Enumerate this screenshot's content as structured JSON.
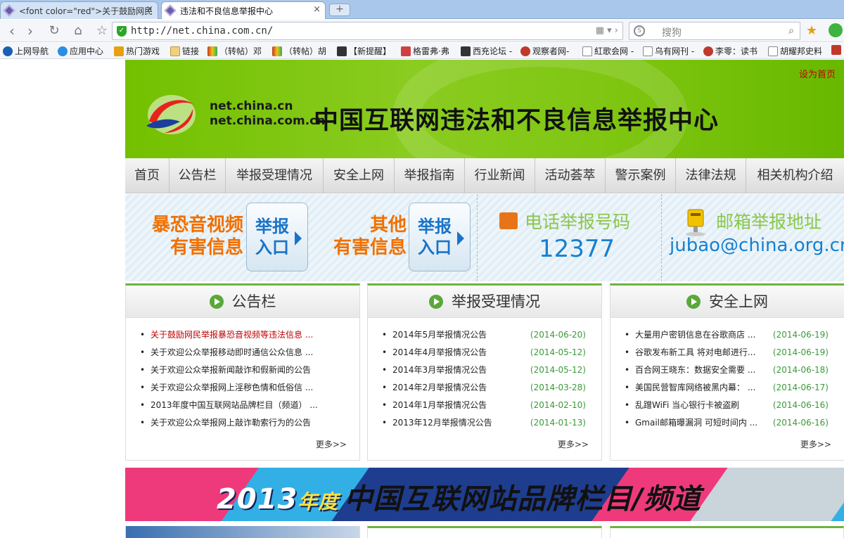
{
  "browser": {
    "tabs": [
      {
        "title": "<font color=\"red\">关于鼓励网民",
        "active": false
      },
      {
        "title": "违法和不良信息举报中心",
        "active": true
      }
    ],
    "new_tab": "+",
    "url": "http://net.china.com.cn/",
    "search_placeholder": "搜狗",
    "bookmarks": [
      {
        "label": "上网导航",
        "icon": "ie-icon",
        "color": "#1a5fb4"
      },
      {
        "label": "应用中心",
        "icon": "app-center-icon",
        "color": "#2a8ee6"
      },
      {
        "label": "热门游戏",
        "icon": "star-icon",
        "color": "#e6a013"
      },
      {
        "label": "链接",
        "icon": "folder-icon",
        "color": "#f0d080"
      },
      {
        "label": "（转帖）邓",
        "icon": "site-icon",
        "color": "#c0392b"
      },
      {
        "label": "（转帖）胡",
        "icon": "site-icon",
        "color": "#c0392b"
      },
      {
        "label": "【新提醒】",
        "icon": "site-icon",
        "color": "#333333"
      },
      {
        "label": "格雷弗·弗",
        "icon": "site-icon",
        "color": "#d04040"
      },
      {
        "label": "西充论坛 -",
        "icon": "site-icon",
        "color": "#333333"
      },
      {
        "label": "观察者网-",
        "icon": "site-icon",
        "color": "#c0392b"
      },
      {
        "label": "紅歌会网 -",
        "icon": "page-icon",
        "color": "#ffffff"
      },
      {
        "label": "乌有网刊 -",
        "icon": "page-icon",
        "color": "#ffffff"
      },
      {
        "label": "李零：读书",
        "icon": "site-icon",
        "color": "#c0392b"
      },
      {
        "label": "胡耀邦史料",
        "icon": "page-icon",
        "color": "#ffffff"
      }
    ]
  },
  "site": {
    "set_homepage": "设为首页",
    "domain1": "net.china.cn",
    "domain2": "net.china.com.cn",
    "title": "中国互联网违法和不良信息举报中心",
    "menu": [
      "首页",
      "公告栏",
      "举报受理情况",
      "安全上网",
      "举报指南",
      "行业新闻",
      "活动荟萃",
      "警示案例",
      "法律法规",
      "相关机构介绍"
    ],
    "report1_line1": "暴恐音视频",
    "report1_line2": "有害信息",
    "report2_line1": "其他",
    "report2_line2": "有害信息",
    "entry_line1": "举报",
    "entry_line2": "入口",
    "phone_label": "电话举报号码",
    "phone_number": "12377",
    "mail_label": "邮箱举报地址",
    "mail_address": "jubao@china.org.cn",
    "more": "更多>>",
    "panels": [
      {
        "title": "公告栏",
        "items": [
          {
            "text": "关于鼓励网民举报暴恐音视频等违法信息 ...",
            "date": "",
            "highlight": true
          },
          {
            "text": "关于欢迎公众举报移动即时通信公众信息 ...",
            "date": "",
            "highlight": false
          },
          {
            "text": "关于欢迎公众举报新闻敲诈和假新闻的公告",
            "date": "",
            "highlight": false
          },
          {
            "text": "关于欢迎公众举报网上淫秽色情和低俗信 ...",
            "date": "",
            "highlight": false
          },
          {
            "text": "2013年度中国互联网站品牌栏目（频道） ...",
            "date": "",
            "highlight": false
          },
          {
            "text": "关于欢迎公众举报网上敲诈勒索行为的公告",
            "date": "",
            "highlight": false
          }
        ]
      },
      {
        "title": "举报受理情况",
        "items": [
          {
            "text": "2014年5月举报情况公告",
            "date": "(2014-06-20)",
            "highlight": false
          },
          {
            "text": "2014年4月举报情况公告",
            "date": "(2014-05-12)",
            "highlight": false
          },
          {
            "text": "2014年3月举报情况公告",
            "date": "(2014-05-12)",
            "highlight": false
          },
          {
            "text": "2014年2月举报情况公告",
            "date": "(2014-03-28)",
            "highlight": false
          },
          {
            "text": "2014年1月举报情况公告",
            "date": "(2014-02-10)",
            "highlight": false
          },
          {
            "text": "2013年12月举报情况公告",
            "date": "(2014-01-13)",
            "highlight": false
          }
        ]
      },
      {
        "title": "安全上网",
        "items": [
          {
            "text": "大量用户密钥信息在谷歌商店 ...",
            "date": "(2014-06-19)",
            "highlight": false
          },
          {
            "text": "谷歌发布新工具 将对电邮进行...",
            "date": "(2014-06-19)",
            "highlight": false
          },
          {
            "text": "百合网王晓东：数据安全需要 ...",
            "date": "(2014-06-18)",
            "highlight": false
          },
          {
            "text": "美国民营智库网络被黑内幕： ...",
            "date": "(2014-06-17)",
            "highlight": false
          },
          {
            "text": "乱蹭WiFi 当心银行卡被盗刷",
            "date": "(2014-06-16)",
            "highlight": false
          },
          {
            "text": "Gmail邮箱曝漏洞 可短时间内 ...",
            "date": "(2014-06-16)",
            "highlight": false
          }
        ]
      }
    ],
    "brand_year": "2013",
    "brand_suffix": "年度",
    "brand_text": "中国互联网站品牌栏目/频道"
  }
}
